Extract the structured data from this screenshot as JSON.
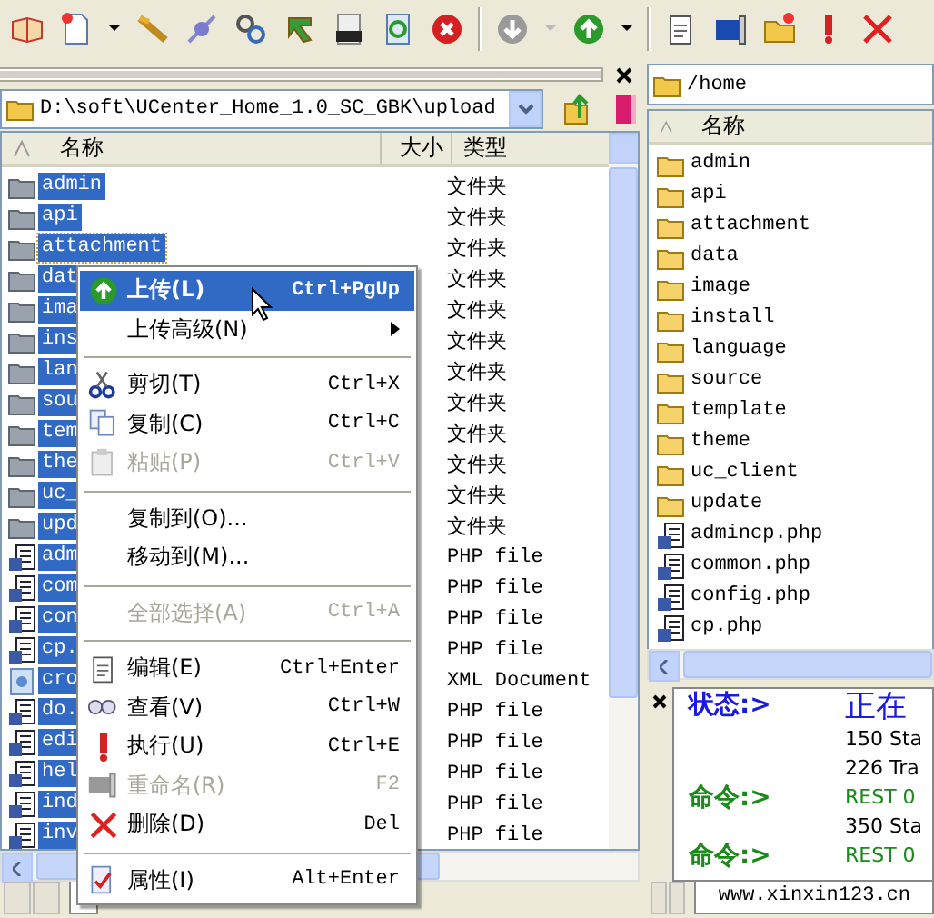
{
  "local_panel": {
    "path": "D:\\soft\\UCenter_Home_1.0_SC_GBK\\upload",
    "columns": [
      "名称",
      "大小",
      "类型"
    ],
    "rows": [
      {
        "name": "admin",
        "kind": "folder",
        "type": "文件夹",
        "selected": true
      },
      {
        "name": "api",
        "kind": "folder",
        "type": "文件夹",
        "selected": true
      },
      {
        "name": "attachment",
        "kind": "folder",
        "type": "文件夹",
        "selected": true
      },
      {
        "name": "dat",
        "kind": "folder",
        "type": "文件夹",
        "selected": true
      },
      {
        "name": "ima",
        "kind": "folder",
        "type": "文件夹",
        "selected": true
      },
      {
        "name": "ins",
        "kind": "folder",
        "type": "文件夹",
        "selected": true
      },
      {
        "name": "lan",
        "kind": "folder",
        "type": "文件夹",
        "selected": true
      },
      {
        "name": "sou",
        "kind": "folder",
        "type": "文件夹",
        "selected": true
      },
      {
        "name": "tem",
        "kind": "folder",
        "type": "文件夹",
        "selected": true
      },
      {
        "name": "the",
        "kind": "folder",
        "type": "文件夹",
        "selected": true
      },
      {
        "name": "uc_",
        "kind": "folder",
        "type": "文件夹",
        "selected": true
      },
      {
        "name": "upd",
        "kind": "folder",
        "type": "文件夹",
        "selected": true
      },
      {
        "name": "adm",
        "kind": "php",
        "type": "PHP file",
        "selected": true
      },
      {
        "name": "com",
        "kind": "php",
        "type": "PHP file",
        "selected": true
      },
      {
        "name": "con",
        "kind": "php",
        "type": "PHP file",
        "selected": true
      },
      {
        "name": "cp.",
        "kind": "php",
        "type": "PHP file",
        "selected": true
      },
      {
        "name": "cro",
        "kind": "xml",
        "type": "XML Document",
        "selected": true
      },
      {
        "name": "do.",
        "kind": "php",
        "type": "PHP file",
        "selected": true
      },
      {
        "name": "edi",
        "kind": "php",
        "type": "PHP file",
        "selected": true
      },
      {
        "name": "hel",
        "kind": "php",
        "type": "PHP file",
        "selected": true
      },
      {
        "name": "ind",
        "kind": "php",
        "type": "PHP file",
        "selected": true
      },
      {
        "name": "inv",
        "kind": "php",
        "type": "PHP file",
        "selected": true
      }
    ]
  },
  "context_menu": {
    "items": [
      {
        "kind": "item",
        "label": "上传(L)",
        "shortcut": "Ctrl+PgUp",
        "selected": true,
        "disabled": false,
        "submenu": false
      },
      {
        "kind": "item",
        "label": "上传高级(N)",
        "selected": false,
        "disabled": false,
        "submenu": true
      },
      {
        "kind": "separator"
      },
      {
        "kind": "item",
        "label": "剪切(T)",
        "shortcut": "Ctrl+X",
        "selected": false,
        "disabled": false,
        "submenu": false
      },
      {
        "kind": "item",
        "label": "复制(C)",
        "shortcut": "Ctrl+C",
        "selected": false,
        "disabled": false,
        "submenu": false
      },
      {
        "kind": "item",
        "label": "粘贴(P)",
        "shortcut": "Ctrl+V",
        "selected": false,
        "disabled": true,
        "submenu": false
      },
      {
        "kind": "separator"
      },
      {
        "kind": "item",
        "label": "复制到(O)...",
        "selected": false,
        "disabled": false,
        "submenu": false
      },
      {
        "kind": "item",
        "label": "移动到(M)...",
        "selected": false,
        "disabled": false,
        "submenu": false
      },
      {
        "kind": "separator"
      },
      {
        "kind": "item",
        "label": "全部选择(A)",
        "shortcut": "Ctrl+A",
        "selected": false,
        "disabled": true,
        "submenu": false
      },
      {
        "kind": "separator"
      },
      {
        "kind": "item",
        "label": "编辑(E)",
        "shortcut": "Ctrl+Enter",
        "selected": false,
        "disabled": false,
        "submenu": false
      },
      {
        "kind": "item",
        "label": "查看(V)",
        "shortcut": "Ctrl+W",
        "selected": false,
        "disabled": false,
        "submenu": false
      },
      {
        "kind": "item",
        "label": "执行(U)",
        "shortcut": "Ctrl+E",
        "selected": false,
        "disabled": false,
        "submenu": false
      },
      {
        "kind": "item",
        "label": "重命名(R)",
        "shortcut": "F2",
        "selected": false,
        "disabled": true,
        "submenu": false
      },
      {
        "kind": "item",
        "label": "删除(D)",
        "shortcut": "Del",
        "selected": false,
        "disabled": false,
        "submenu": false
      },
      {
        "kind": "separator"
      },
      {
        "kind": "item",
        "label": "属性(I)",
        "shortcut": "Alt+Enter",
        "selected": false,
        "disabled": false,
        "submenu": false
      }
    ]
  },
  "remote_panel": {
    "path": "/home",
    "columns": [
      "名称"
    ],
    "rows": [
      {
        "name": "admin",
        "kind": "folder"
      },
      {
        "name": "api",
        "kind": "folder"
      },
      {
        "name": "attachment",
        "kind": "folder"
      },
      {
        "name": "data",
        "kind": "folder"
      },
      {
        "name": "image",
        "kind": "folder"
      },
      {
        "name": "install",
        "kind": "folder"
      },
      {
        "name": "language",
        "kind": "folder"
      },
      {
        "name": "source",
        "kind": "folder"
      },
      {
        "name": "template",
        "kind": "folder"
      },
      {
        "name": "theme",
        "kind": "folder"
      },
      {
        "name": "uc_client",
        "kind": "folder"
      },
      {
        "name": "update",
        "kind": "folder"
      },
      {
        "name": "admincp.php",
        "kind": "php"
      },
      {
        "name": "common.php",
        "kind": "php"
      },
      {
        "name": "config.php",
        "kind": "php"
      },
      {
        "name": "cp.php",
        "kind": "php"
      }
    ]
  },
  "log": [
    {
      "kind": "status",
      "label": "状态:>",
      "text": "正在"
    },
    {
      "kind": "response",
      "text": "150 Sta"
    },
    {
      "kind": "response",
      "text": "226 Tra"
    },
    {
      "kind": "command",
      "label": "命令:>",
      "text": "REST 0"
    },
    {
      "kind": "response",
      "text": "350 Sta"
    },
    {
      "kind": "command",
      "label": "命令:>",
      "text": "REST 0"
    }
  ],
  "session_tab": "www.xinxin123.cn"
}
